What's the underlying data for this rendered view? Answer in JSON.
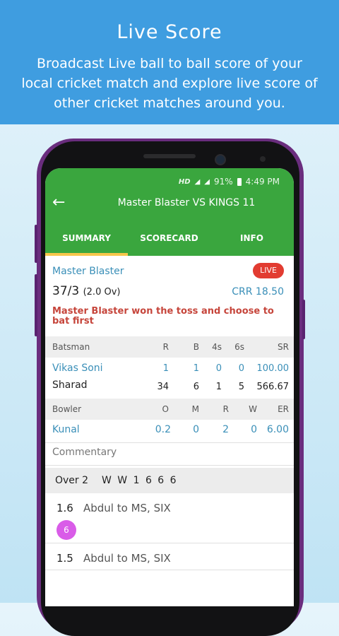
{
  "promo": {
    "title": "Live Score",
    "description": "Broadcast Live ball to ball score of your local cricket match and explore live score of other cricket matches around you."
  },
  "status_bar": {
    "hd": "HD",
    "battery": "91%",
    "time": "4:49 PM"
  },
  "toolbar": {
    "title": "Master Blaster VS KINGS 11"
  },
  "tabs": [
    {
      "label": "SUMMARY",
      "active": true
    },
    {
      "label": "SCORECARD",
      "active": false
    },
    {
      "label": "INFO",
      "active": false
    }
  ],
  "match": {
    "team": "Master Blaster",
    "live_badge": "LIVE",
    "score": "37/3",
    "overs": "(2.0 Ov)",
    "crr": "CRR 18.50",
    "toss": "Master Blaster won the toss and choose to bat first"
  },
  "batting": {
    "headers": [
      "Batsman",
      "R",
      "B",
      "4s",
      "6s",
      "SR"
    ],
    "rows": [
      {
        "name": "Vikas Soni",
        "R": "1",
        "B": "1",
        "4s": "0",
        "6s": "0",
        "SR": "100.00",
        "on_strike": true
      },
      {
        "name": "Sharad",
        "R": "34",
        "B": "6",
        "4s": "1",
        "6s": "5",
        "SR": "566.67",
        "on_strike": false
      }
    ]
  },
  "bowling": {
    "headers": [
      "Bowler",
      "O",
      "M",
      "R",
      "W",
      "ER"
    ],
    "rows": [
      {
        "name": "Kunal",
        "O": "0.2",
        "M": "0",
        "R": "2",
        "W": "0",
        "ER": "6.00"
      }
    ]
  },
  "commentary": {
    "title": "Commentary",
    "over_label": "Over 2",
    "over_balls": "W W 1 6 6 6",
    "balls": [
      {
        "num": "1.6",
        "text": "Abdul to MS, SIX",
        "badge": "6"
      },
      {
        "num": "1.5",
        "text": "Abdul to MS, SIX"
      }
    ]
  },
  "colors": {
    "app_green": "#3aa63e",
    "promo_blue": "#3f9de0",
    "live_red": "#e23c31",
    "link_blue": "#3a8fb8",
    "toss_red": "#c6453b",
    "six_badge": "#d95ce8",
    "phone_purple": "#6a2d7e"
  }
}
